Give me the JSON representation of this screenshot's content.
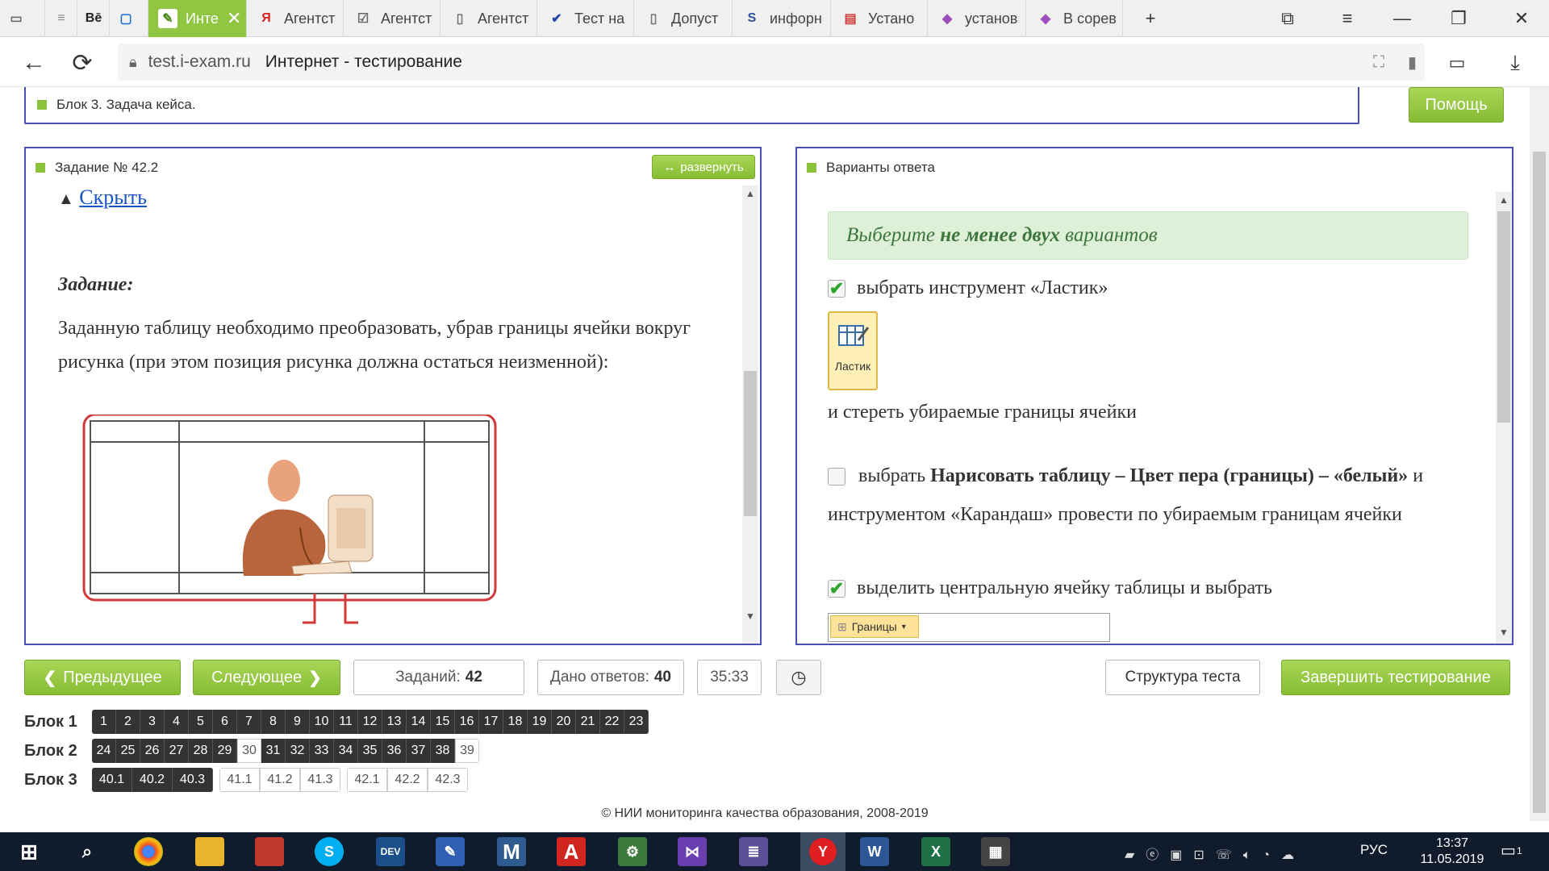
{
  "browser": {
    "tabs": [
      {
        "label": "",
        "icon": "sidebar-icon"
      },
      {
        "label": "",
        "icon": "cisco-icon"
      },
      {
        "label": "",
        "icon": "behance-icon"
      },
      {
        "label": "",
        "icon": "chat-icon"
      },
      {
        "label": "Инте",
        "icon": "exam-icon",
        "active": true
      },
      {
        "label": "Агентст",
        "icon": "yandex-icon"
      },
      {
        "label": "Агентст",
        "icon": "checkbox-icon"
      },
      {
        "label": "Агентст",
        "icon": "document-icon"
      },
      {
        "label": "Тест на",
        "icon": "check-icon"
      },
      {
        "label": "Допуст",
        "icon": "document-icon"
      },
      {
        "label": "инфорн",
        "icon": "s-icon"
      },
      {
        "label": "Устано",
        "icon": "red-icon"
      },
      {
        "label": "установ",
        "icon": "cube-icon"
      },
      {
        "label": "В сорев",
        "icon": "cube-icon"
      }
    ],
    "tab_close": "✕",
    "new_tab": "+",
    "url_host": "test.i-exam.ru",
    "page_title": "Интернет - тестирование"
  },
  "header": {
    "block_title": "Блок 3. Задача кейса.",
    "help_label": "Помощь"
  },
  "task": {
    "title": "Задание № 42.2",
    "expand_label": "развернуть",
    "hide_label": "Скрыть",
    "heading": "Задание:",
    "text": "Заданную таблицу необходимо преобразовать, убрав границы ячейки вокруг рисунка (при этом позиция рисунка должна остаться неизменной):"
  },
  "answers": {
    "title": "Варианты ответа",
    "instruction_pre": "Выберите ",
    "instruction_bold": "не менее двух",
    "instruction_post": " вариантов",
    "options": [
      {
        "checked": true,
        "text": "выбрать инструмент «Ластик»",
        "icon_label": "Ластик",
        "text_after": "и стереть убираемые границы ячейки"
      },
      {
        "checked": false,
        "text_pre": "выбрать ",
        "text_bold1": "Нарисовать таблицу – Цвет пера (границы) – «белый»",
        "text_post": " и инструментом «Карандаш» провести по убираемым границам ячейки"
      },
      {
        "checked": true,
        "text": "выделить центральную ячейку таблицы и выбрать",
        "icon_label": "Границы"
      }
    ]
  },
  "nav": {
    "prev_label": "Предыдущее",
    "next_label": "Следующее",
    "tasks_label": "Заданий:",
    "tasks_count": "42",
    "answered_label": "Дано ответов:",
    "answered_count": "40",
    "timer": "35:33",
    "structure_label": "Структура теста",
    "finish_label": "Завершить тестирование"
  },
  "blocks": [
    {
      "label": "Блок 1",
      "groups": [
        [
          {
            "n": "1",
            "done": true
          },
          {
            "n": "2",
            "done": true
          },
          {
            "n": "3",
            "done": true
          },
          {
            "n": "4",
            "done": true
          },
          {
            "n": "5",
            "done": true
          },
          {
            "n": "6",
            "done": true
          },
          {
            "n": "7",
            "done": true
          },
          {
            "n": "8",
            "done": true
          },
          {
            "n": "9",
            "done": true
          },
          {
            "n": "10",
            "done": true
          },
          {
            "n": "11",
            "done": true
          },
          {
            "n": "12",
            "done": true
          },
          {
            "n": "13",
            "done": true
          },
          {
            "n": "14",
            "done": true
          },
          {
            "n": "15",
            "done": true
          },
          {
            "n": "16",
            "done": true
          },
          {
            "n": "17",
            "done": true
          },
          {
            "n": "18",
            "done": true
          },
          {
            "n": "19",
            "done": true
          },
          {
            "n": "20",
            "done": true
          },
          {
            "n": "21",
            "done": true
          },
          {
            "n": "22",
            "done": true
          },
          {
            "n": "23",
            "done": true
          }
        ]
      ]
    },
    {
      "label": "Блок 2",
      "groups": [
        [
          {
            "n": "24",
            "done": true
          },
          {
            "n": "25",
            "done": true
          },
          {
            "n": "26",
            "done": true
          },
          {
            "n": "27",
            "done": true
          },
          {
            "n": "28",
            "done": true
          },
          {
            "n": "29",
            "done": true
          },
          {
            "n": "30",
            "done": false
          },
          {
            "n": "31",
            "done": true
          },
          {
            "n": "32",
            "done": true
          },
          {
            "n": "33",
            "done": true
          },
          {
            "n": "34",
            "done": true
          },
          {
            "n": "35",
            "done": true
          },
          {
            "n": "36",
            "done": true
          },
          {
            "n": "37",
            "done": true
          },
          {
            "n": "38",
            "done": true
          },
          {
            "n": "39",
            "done": false
          }
        ]
      ]
    },
    {
      "label": "Блок 3",
      "groups": [
        [
          {
            "n": "40.1",
            "done": true
          },
          {
            "n": "40.2",
            "done": true
          },
          {
            "n": "40.3",
            "done": true
          }
        ],
        [
          {
            "n": "41.1",
            "done": false
          },
          {
            "n": "41.2",
            "done": false
          },
          {
            "n": "41.3",
            "done": false
          }
        ],
        [
          {
            "n": "42.1",
            "done": false
          },
          {
            "n": "42.2",
            "done": false
          },
          {
            "n": "42.3",
            "done": false
          }
        ]
      ]
    }
  ],
  "footer": {
    "copyright": "© НИИ мониторинга качества образования, 2008-2019"
  },
  "taskbar": {
    "time": "13:37",
    "date": "11.05.2019",
    "lang": "РУС",
    "notif_count": "1"
  },
  "colors": {
    "accent": "#8cc13b",
    "panel_border": "#4a4fb5",
    "taskbar": "#101c2c"
  }
}
